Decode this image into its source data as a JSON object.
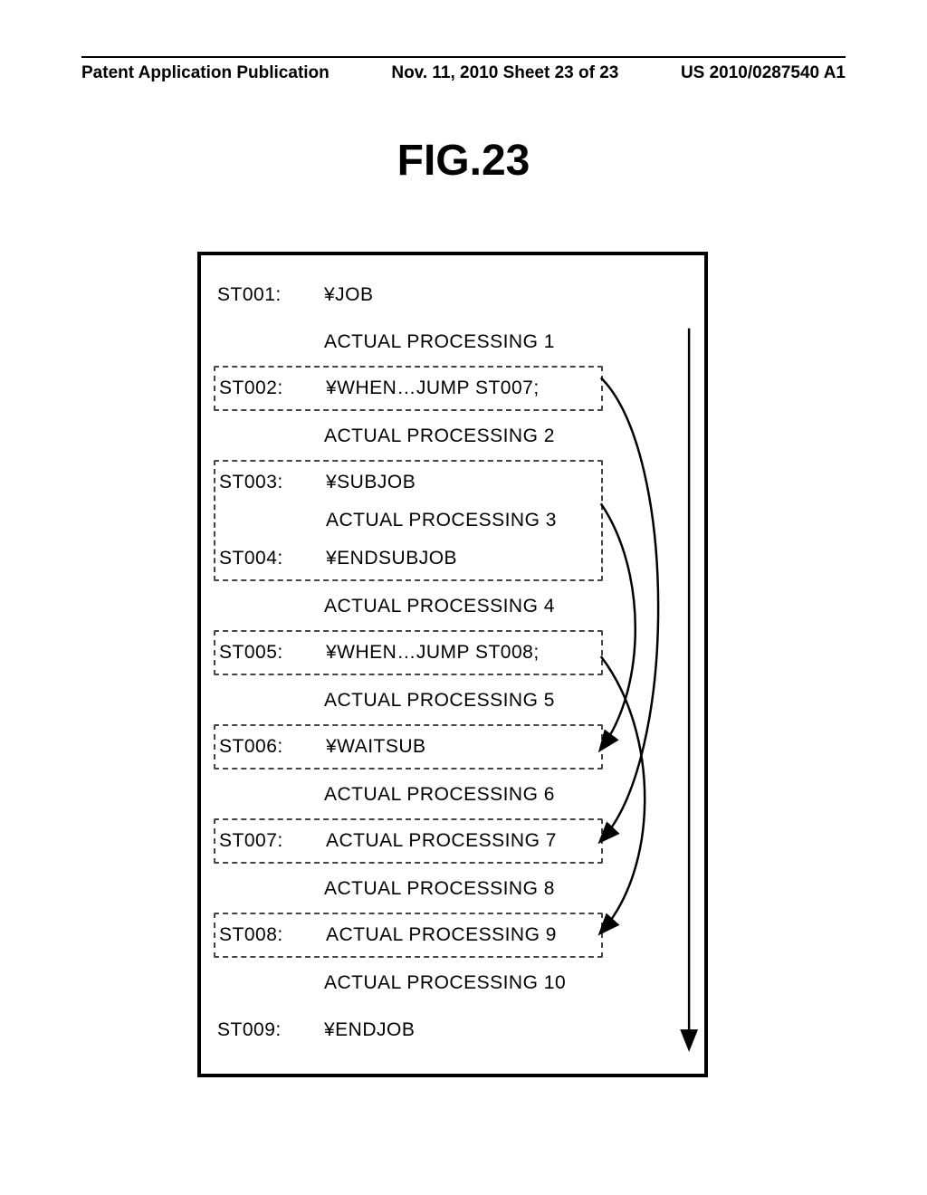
{
  "header": {
    "left": "Patent Application Publication",
    "center": "Nov. 11, 2010  Sheet 23 of 23",
    "right": "US 2010/0287540 A1"
  },
  "figure_title": "FIG.23",
  "rows": [
    {
      "step": "ST001:",
      "cmd": "¥JOB"
    },
    {
      "step": "",
      "cmd": "ACTUAL PROCESSING 1"
    },
    {
      "step": "ST002:",
      "cmd": "¥WHEN…JUMP ST007;"
    },
    {
      "step": "",
      "cmd": "ACTUAL PROCESSING 2"
    },
    {
      "step": "ST003:",
      "cmd": "¥SUBJOB"
    },
    {
      "step": "",
      "cmd": "ACTUAL PROCESSING 3"
    },
    {
      "step": "ST004:",
      "cmd": "¥ENDSUBJOB"
    },
    {
      "step": "",
      "cmd": "ACTUAL PROCESSING 4"
    },
    {
      "step": "ST005:",
      "cmd": "¥WHEN…JUMP ST008;"
    },
    {
      "step": "",
      "cmd": "ACTUAL PROCESSING 5"
    },
    {
      "step": "ST006:",
      "cmd": "¥WAITSUB"
    },
    {
      "step": "",
      "cmd": "ACTUAL PROCESSING 6"
    },
    {
      "step": "ST007:",
      "cmd": "ACTUAL PROCESSING 7"
    },
    {
      "step": "",
      "cmd": "ACTUAL PROCESSING 8"
    },
    {
      "step": "ST008:",
      "cmd": "ACTUAL PROCESSING 9"
    },
    {
      "step": "",
      "cmd": "ACTUAL PROCESSING 10"
    },
    {
      "step": "ST009:",
      "cmd": "¥ENDJOB"
    }
  ]
}
